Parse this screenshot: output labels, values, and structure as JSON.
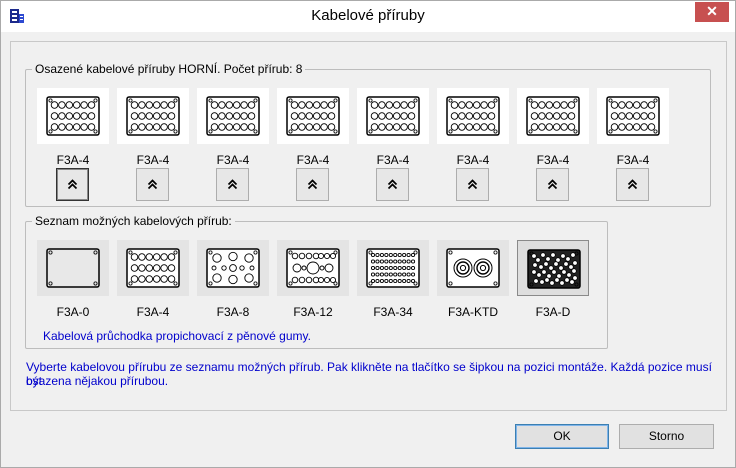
{
  "window": {
    "title": "Kabelové příruby",
    "close_symbol": "✕"
  },
  "installed": {
    "legend": "Osazené kabelové příruby HORNÍ. Počet přírub: 8",
    "slots": [
      {
        "label": "F3A-4",
        "icon": "flange-4-icon"
      },
      {
        "label": "F3A-4",
        "icon": "flange-4-icon"
      },
      {
        "label": "F3A-4",
        "icon": "flange-4-icon"
      },
      {
        "label": "F3A-4",
        "icon": "flange-4-icon"
      },
      {
        "label": "F3A-4",
        "icon": "flange-4-icon"
      },
      {
        "label": "F3A-4",
        "icon": "flange-4-icon"
      },
      {
        "label": "F3A-4",
        "icon": "flange-4-icon"
      },
      {
        "label": "F3A-4",
        "icon": "flange-4-icon"
      }
    ],
    "mount_button_icon": "double-chevron-up-icon"
  },
  "available": {
    "legend": "Seznam možných kabelových přírub:",
    "items": [
      {
        "label": "F3A-0"
      },
      {
        "label": "F3A-4"
      },
      {
        "label": "F3A-8"
      },
      {
        "label": "F3A-12"
      },
      {
        "label": "F3A-34"
      },
      {
        "label": "F3A-KTD"
      },
      {
        "label": "F3A-D"
      }
    ],
    "selected_index": 6,
    "description": "Kabelová průchodka propichovací z pěnové gumy."
  },
  "instructions": {
    "line1": "Vyberte kabelovou přírubu ze seznamu možných přírub. Pak klikněte na tlačítko se šipkou na pozici montáže. Každá pozice musí být",
    "line2": "osazena nějakou přírubou."
  },
  "buttons": {
    "ok": "OK",
    "cancel": "Storno"
  },
  "colors": {
    "close_bg": "#c75050",
    "link_text": "#0000cc"
  }
}
